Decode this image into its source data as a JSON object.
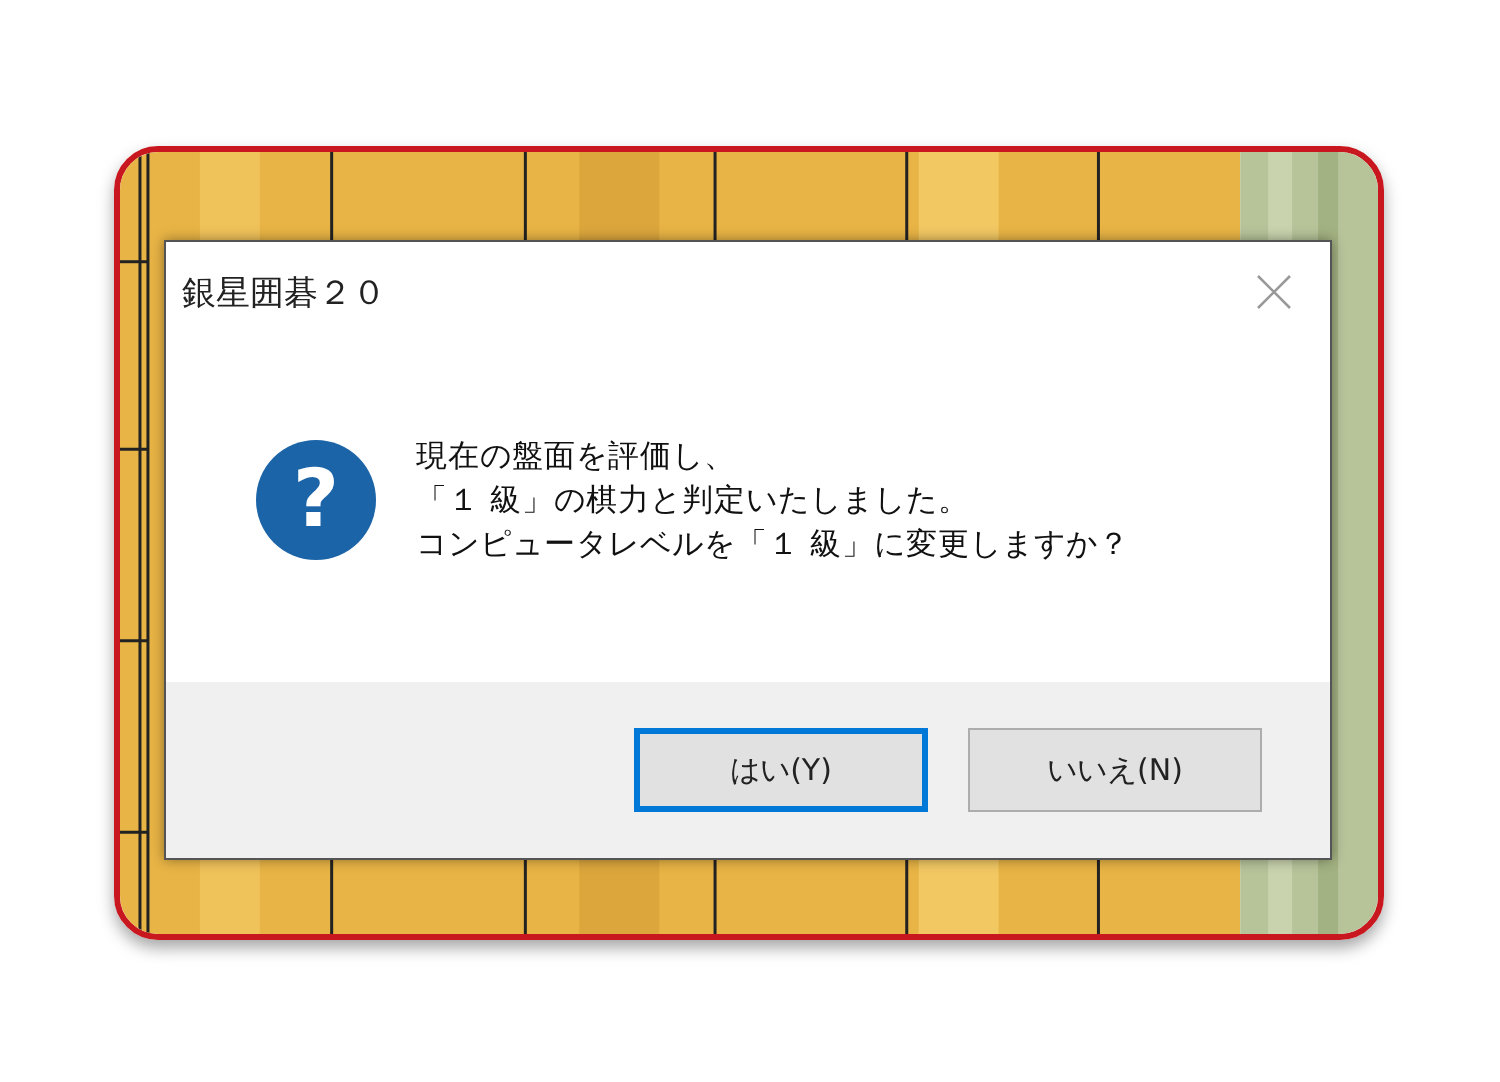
{
  "dialog": {
    "title": "銀星囲碁２０",
    "icon": {
      "kind": "question",
      "glyph": "?"
    },
    "message_lines": [
      "現在の盤面を評価し、",
      "「１ 級」の棋力と判定いたしました。",
      "コンピュータレベルを「１ 級」に変更しますか？"
    ],
    "buttons": [
      {
        "label": "はい(Y)",
        "selected": true
      },
      {
        "label": "いいえ(N)",
        "selected": false
      }
    ]
  }
}
